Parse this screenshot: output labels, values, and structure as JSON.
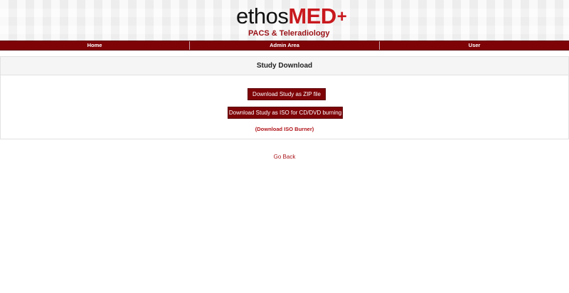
{
  "header": {
    "logo_text_main": "ethos",
    "logo_text_brand": "MED",
    "logo_plus": "+",
    "tagline": "PACS & Teleradiology"
  },
  "nav": {
    "items": [
      {
        "label": "Home"
      },
      {
        "label": "Admin Area"
      },
      {
        "label": "User"
      }
    ]
  },
  "panel": {
    "title": "Study Download",
    "zip_button": "Download Study as ZIP file",
    "iso_button": "Download Study as ISO for CD/DVD burning",
    "burner_link": "(Download ISO Burner)"
  },
  "footer": {
    "go_back": "Go Back"
  },
  "colors": {
    "brand_red": "#c8191e",
    "nav_bg": "#7e0307",
    "button_bg": "#7e0307",
    "link_red": "#b0141a"
  }
}
